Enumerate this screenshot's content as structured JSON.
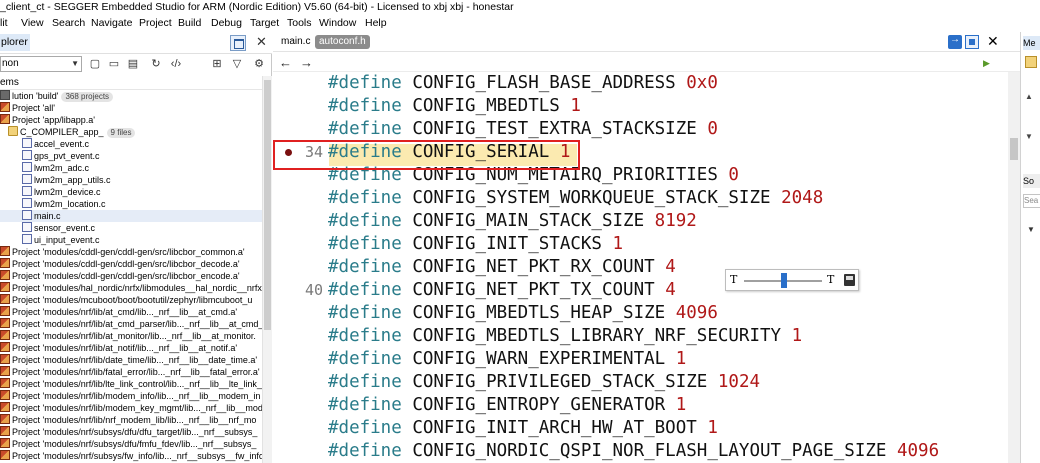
{
  "window": {
    "title": "_client_ct - SEGGER Embedded Studio for ARM (Nordic Edition) V5.60 (64-bit) - Licensed to xbj xbj - honestar"
  },
  "menu": [
    "lit",
    "View",
    "Search",
    "Navigate",
    "Project",
    "Build",
    "Debug",
    "Target",
    "Tools",
    "Window",
    "Help"
  ],
  "explorer": {
    "title": "plorer",
    "combo_value": "non",
    "column_header": "ems",
    "items": [
      {
        "label": "lution 'build'",
        "badge": "368 projects",
        "icon": "solution-icon",
        "indent": 0
      },
      {
        "label": "Project 'all'",
        "icon": "project-icon",
        "indent": 0
      },
      {
        "label": "Project 'app/libapp.a'",
        "icon": "project-icon",
        "indent": 0
      },
      {
        "label": "C_COMPILER_app_",
        "badge": "9 files",
        "icon": "folder-icon",
        "indent": 8
      },
      {
        "label": "accel_event.c",
        "icon": "c-file-icon",
        "indent": 22
      },
      {
        "label": "gps_pvt_event.c",
        "icon": "c-file-icon",
        "indent": 22
      },
      {
        "label": "lwm2m_adc.c",
        "icon": "c-file-icon",
        "indent": 22
      },
      {
        "label": "lwm2m_app_utils.c",
        "icon": "c-file-icon",
        "indent": 22
      },
      {
        "label": "lwm2m_device.c",
        "icon": "c-file-icon",
        "indent": 22
      },
      {
        "label": "lwm2m_location.c",
        "icon": "c-file-icon",
        "indent": 22
      },
      {
        "label": "main.c",
        "icon": "c-file-icon",
        "indent": 22,
        "selected": true
      },
      {
        "label": "sensor_event.c",
        "icon": "c-file-icon",
        "indent": 22
      },
      {
        "label": "ui_input_event.c",
        "icon": "c-file-icon",
        "indent": 22
      },
      {
        "label": "Project 'modules/cddl-gen/cddl-gen/src/libcbor_common.a'",
        "icon": "project-icon",
        "indent": 0
      },
      {
        "label": "Project 'modules/cddl-gen/cddl-gen/src/libcbor_decode.a'",
        "icon": "project-icon",
        "indent": 0
      },
      {
        "label": "Project 'modules/cddl-gen/cddl-gen/src/libcbor_encode.a'",
        "icon": "project-icon",
        "indent": 0
      },
      {
        "label": "Project 'modules/hal_nordic/nrfx/libmodules__hal_nordic__nrfx",
        "icon": "project-icon",
        "indent": 0
      },
      {
        "label": "Project 'modules/mcuboot/boot/bootutil/zephyr/libmcuboot_u",
        "icon": "project-icon",
        "indent": 0
      },
      {
        "label": "Project 'modules/nrf/lib/at_cmd/lib..._nrf__lib__at_cmd.a'",
        "icon": "project-icon",
        "indent": 0
      },
      {
        "label": "Project 'modules/nrf/lib/at_cmd_parser/lib..._nrf__lib__at_cmd_",
        "icon": "project-icon",
        "indent": 0
      },
      {
        "label": "Project 'modules/nrf/lib/at_monitor/lib..._nrf__lib__at_monitor.",
        "icon": "project-icon",
        "indent": 0
      },
      {
        "label": "Project 'modules/nrf/lib/at_notif/lib..._nrf__lib__at_notif.a'",
        "icon": "project-icon",
        "indent": 0
      },
      {
        "label": "Project 'modules/nrf/lib/date_time/lib..._nrf__lib__date_time.a'",
        "icon": "project-icon",
        "indent": 0
      },
      {
        "label": "Project 'modules/nrf/lib/fatal_error/lib..._nrf__lib__fatal_error.a'",
        "icon": "project-icon",
        "indent": 0
      },
      {
        "label": "Project 'modules/nrf/lib/lte_link_control/lib..._nrf__lib__lte_link_",
        "icon": "project-icon",
        "indent": 0
      },
      {
        "label": "Project 'modules/nrf/lib/modem_info/lib..._nrf__lib__modem_in",
        "icon": "project-icon",
        "indent": 0
      },
      {
        "label": "Project 'modules/nrf/lib/modem_key_mgmt/lib..._nrf__lib__mod",
        "icon": "project-icon",
        "indent": 0
      },
      {
        "label": "Project 'modules/nrf/lib/nrf_modem_lib/lib..._nrf__lib__nrf_mo",
        "icon": "project-icon",
        "indent": 0
      },
      {
        "label": "Project 'modules/nrf/subsys/dfu/dfu_target/lib..._nrf__subsys_",
        "icon": "project-icon",
        "indent": 0
      },
      {
        "label": "Project 'modules/nrf/subsys/dfu/fmfu_fdev/lib..._nrf__subsys_",
        "icon": "project-icon",
        "indent": 0
      },
      {
        "label": "Project 'modules/nrf/subsys/fw_info/lib..._nrf__subsys__fw_info",
        "icon": "project-icon",
        "indent": 0
      }
    ]
  },
  "editor": {
    "tabs": [
      {
        "label": "main.c"
      },
      {
        "label": "autoconf.h"
      }
    ],
    "lines": [
      {
        "num": "",
        "name": "CONFIG_FLASH_BASE_ADDRESS",
        "value": "0x0"
      },
      {
        "num": "",
        "name": "CONFIG_MBEDTLS",
        "value": "1"
      },
      {
        "num": "",
        "name": "CONFIG_TEST_EXTRA_STACKSIZE",
        "value": "0"
      },
      {
        "num": "34",
        "name": "CONFIG_SERIAL",
        "value": "1",
        "breakpoint": true,
        "highlighted": true
      },
      {
        "num": "",
        "name": "CONFIG_NUM_METAIRQ_PRIORITIES",
        "value": "0"
      },
      {
        "num": "",
        "name": "CONFIG_SYSTEM_WORKQUEUE_STACK_SIZE",
        "value": "2048"
      },
      {
        "num": "",
        "name": "CONFIG_MAIN_STACK_SIZE",
        "value": "8192"
      },
      {
        "num": "",
        "name": "CONFIG_INIT_STACKS",
        "value": "1"
      },
      {
        "num": "",
        "name": "CONFIG_NET_PKT_RX_COUNT",
        "value": "4"
      },
      {
        "num": "40",
        "name": "CONFIG_NET_PKT_TX_COUNT",
        "value": "4"
      },
      {
        "num": "",
        "name": "CONFIG_MBEDTLS_HEAP_SIZE",
        "value": "4096"
      },
      {
        "num": "",
        "name": "CONFIG_MBEDTLS_LIBRARY_NRF_SECURITY",
        "value": "1"
      },
      {
        "num": "",
        "name": "CONFIG_WARN_EXPERIMENTAL",
        "value": "1"
      },
      {
        "num": "",
        "name": "CONFIG_PRIVILEGED_STACK_SIZE",
        "value": "1024"
      },
      {
        "num": "",
        "name": "CONFIG_ENTROPY_GENERATOR",
        "value": "1"
      },
      {
        "num": "",
        "name": "CONFIG_INIT_ARCH_HW_AT_BOOT",
        "value": "1"
      },
      {
        "num": "",
        "name": "CONFIG_NORDIC_QSPI_NOR_FLASH_LAYOUT_PAGE_SIZE",
        "value": "4096"
      }
    ],
    "keyword": "#define",
    "zoom_small_label": "T",
    "zoom_large_label": "T"
  },
  "right_panel": {
    "header": "Me",
    "header2": "So",
    "input_placeholder": "Sea"
  },
  "colors": {
    "keyword": "#2a7c8a",
    "value": "#b01818",
    "highlight": "#fbeab0",
    "highlight_border": "#e02020",
    "breakpoint": "#7a1010"
  }
}
